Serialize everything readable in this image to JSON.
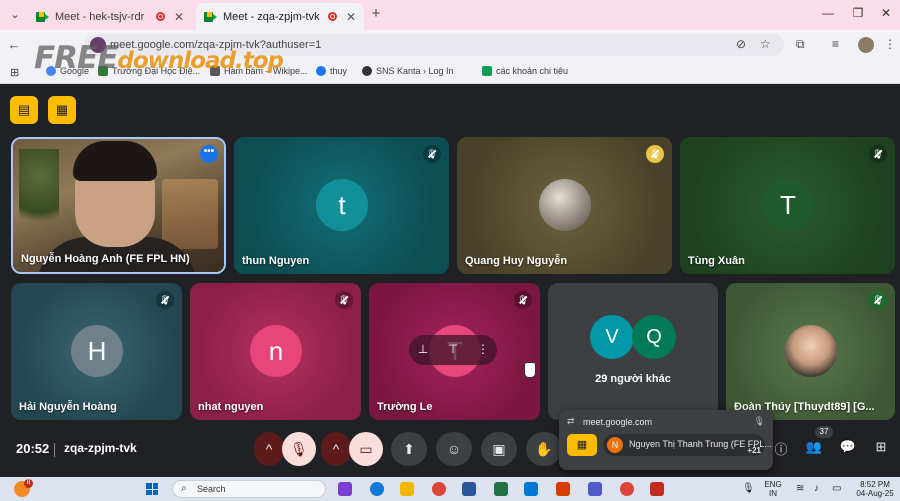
{
  "browser": {
    "tabs": [
      {
        "title": "Meet - hek-tsjv-rdr",
        "active": false
      },
      {
        "title": "Meet - zqa-zpjm-tvk",
        "active": true
      }
    ],
    "url": "meet.google.com/zqa-zpjm-tvk?authuser=1",
    "bookmarks": [
      {
        "label": "Google",
        "icon_color": "#4285f4"
      },
      {
        "label": "Trường Đại Học Điệ...",
        "icon_color": "#2e7d32"
      },
      {
        "label": "Hàm bám – Wikipe...",
        "icon_color": "#555555"
      },
      {
        "label": "thuy",
        "icon_color": "#1877f2"
      },
      {
        "label": "SNS Kanta › Log In",
        "icon_color": "#333333"
      },
      {
        "label": "các khoản chi tiêu",
        "icon_color": "#0f9d58"
      }
    ]
  },
  "watermark": {
    "free": "FREE",
    "download": "download",
    "top": ".top"
  },
  "meeting": {
    "time": "20:52",
    "code": "zqa-zpjm-tvk",
    "participants_badge": "37",
    "participants": [
      {
        "name": "Nguyễn Hoàng Anh (FE FPL HN)",
        "type": "video",
        "speaking": true
      },
      {
        "name": "thun Nguyen",
        "initial": "t",
        "color": "#12838a",
        "bg": "#0f5c62"
      },
      {
        "name": "Quang Huy Nguyễn",
        "type": "photo",
        "bg": "#6b5d3a"
      },
      {
        "name": "Tùng Xuân",
        "initial": "T",
        "color": "#1e5e2e",
        "bg": "#234d26"
      },
      {
        "name": "Hải Nguyễn Hoàng",
        "initial": "H",
        "color": "#6e8188",
        "bg": "#2f5560"
      },
      {
        "name": "nhat nguyen",
        "initial": "n",
        "color": "#e8457a",
        "bg": "#a6264f"
      },
      {
        "name": "Trường Le",
        "initial": "T",
        "color": "#e8457a",
        "bg": "#8e1a47"
      },
      {
        "others": "29 người khác",
        "initials": [
          "V",
          "Q"
        ],
        "colors": [
          "#0097a7",
          "#007b57"
        ],
        "bg": "#3c4043"
      },
      {
        "name": "Đoàn Thúy [Thuydt89] [G...",
        "type": "photo",
        "bg": "#4a6440"
      }
    ],
    "popup": {
      "url": "meet.google.com",
      "avatar": "N",
      "name": "Nguyen Thị Thanh Trung (FE FPL...",
      "more": "+21"
    }
  },
  "taskbar": {
    "search_placeholder": "Search",
    "notification_count": "8",
    "lang": "ENG",
    "region": "IN",
    "time": "8:52 PM",
    "date": "04-Aug-25"
  }
}
